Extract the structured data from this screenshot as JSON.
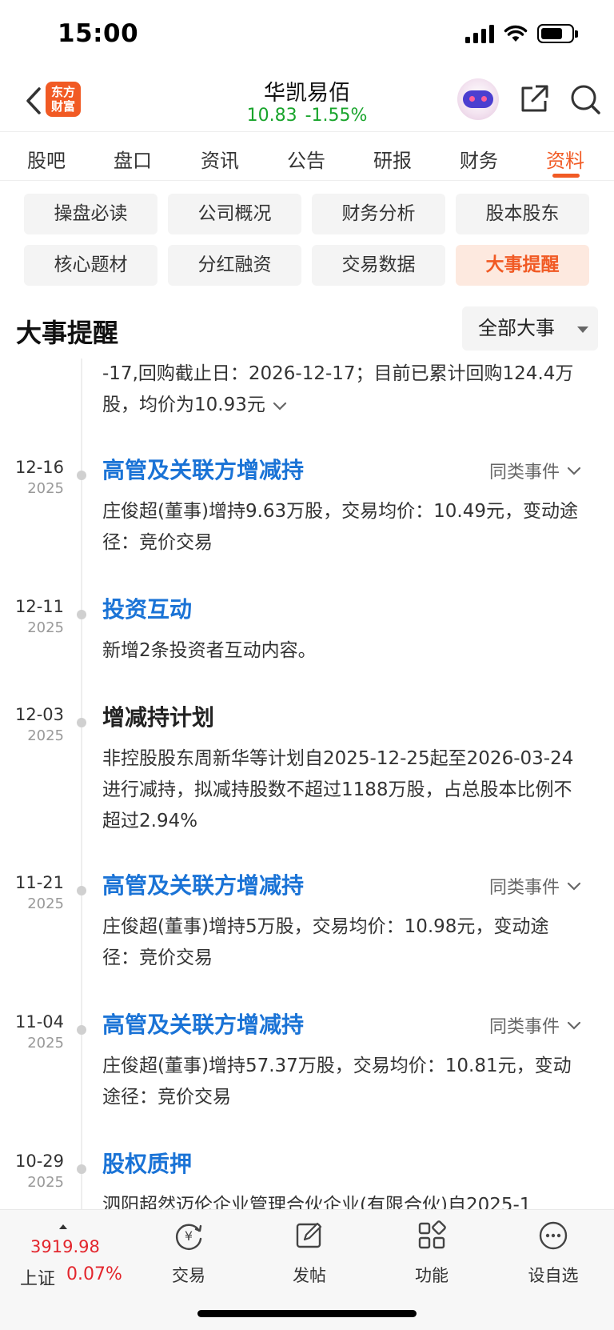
{
  "status_bar": {
    "time": "15:00"
  },
  "header": {
    "logo_text": "东方财富",
    "stock_name": "华凯易佰",
    "price": "10.83",
    "change": "-1.55%",
    "price_color": "#18a42b"
  },
  "main_tabs": [
    "股吧",
    "盘口",
    "资讯",
    "公告",
    "研报",
    "财务",
    "资料"
  ],
  "main_tab_active": "资料",
  "sub_tabs": [
    "操盘必读",
    "公司概况",
    "财务分析",
    "股本股东",
    "核心题材",
    "分红融资",
    "交易数据",
    "大事提醒"
  ],
  "sub_tab_active": "大事提醒",
  "section": {
    "title": "大事提醒",
    "filter_label": "全部大事"
  },
  "partial_event": {
    "desc": "-17,回购截止日：2026-12-17；目前已累计回购124.4万股，均价为10.93元"
  },
  "events": [
    {
      "date": "12-16",
      "year": "2025",
      "title": "高管及关联方增减持",
      "similar": "同类事件",
      "desc": "庄俊超(董事)增持9.63万股，交易均价：10.49元，变动途径：竞价交易"
    },
    {
      "date": "12-11",
      "year": "2025",
      "title": "投资互动",
      "desc": "新增2条投资者互动内容。"
    },
    {
      "date": "12-03",
      "year": "2025",
      "title": "增减持计划",
      "desc": "非控股股东周新华等计划自2025-12-25起至2026-03-24进行减持，拟减持股数不超过1188万股，占总股本比例不超过2.94%"
    },
    {
      "date": "11-21",
      "year": "2025",
      "title": "高管及关联方增减持",
      "similar": "同类事件",
      "desc": "庄俊超(董事)增持5万股，交易均价：10.98元，变动途径：竞价交易"
    },
    {
      "date": "11-04",
      "year": "2025",
      "title": "高管及关联方增减持",
      "similar": "同类事件",
      "desc": "庄俊超(董事)增持57.37万股，交易均价：10.81元，变动途径：竞价交易"
    },
    {
      "date": "10-29",
      "year": "2025",
      "title": "股权质押",
      "desc": "泗阳超然迈伦企业管理合伙企业(有限合伙)自2025-1"
    }
  ],
  "bottom_bar": {
    "index_value": "3919.98",
    "index_name": "上证",
    "index_change": "0.07%",
    "nav": [
      "交易",
      "发帖",
      "功能",
      "设自选"
    ]
  },
  "colors": {
    "accent": "#f15a24",
    "link_blue": "#1a73d6",
    "up_red": "#e3262d"
  }
}
